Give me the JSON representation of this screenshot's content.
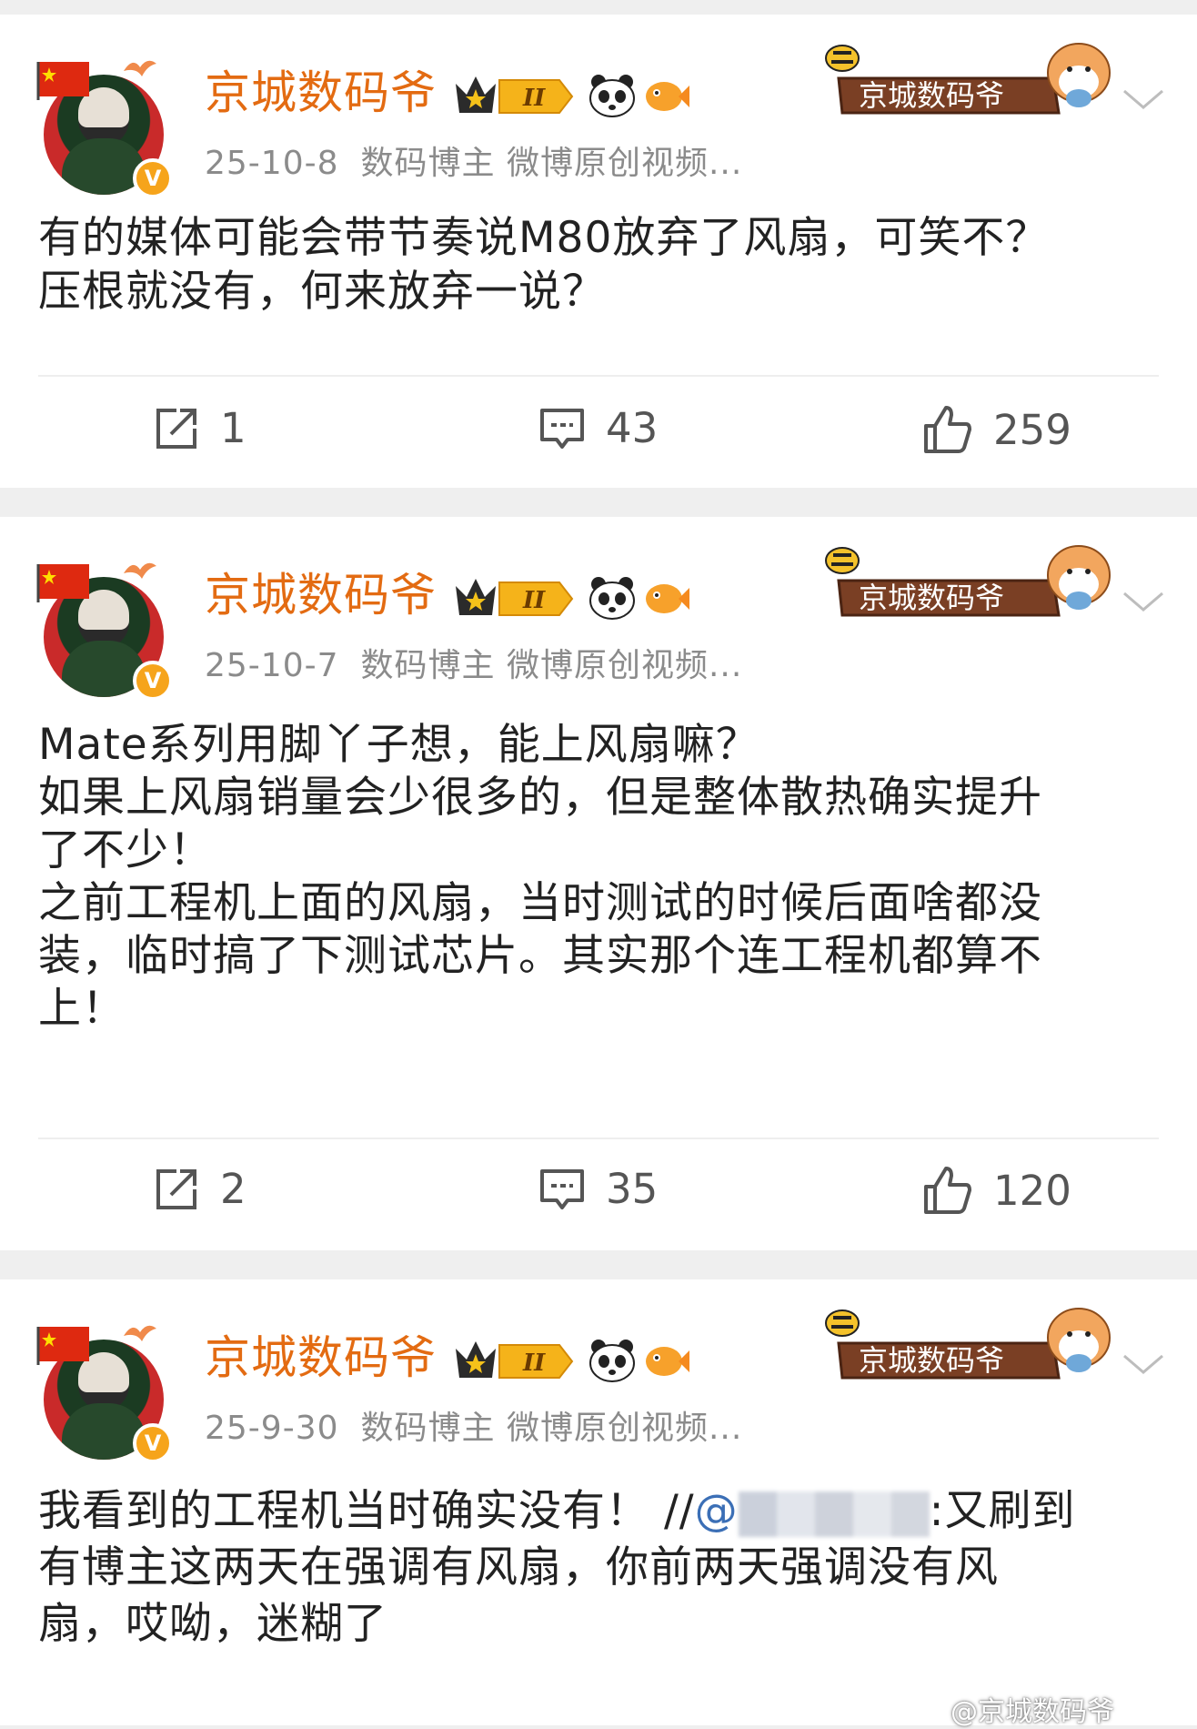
{
  "posts": [
    {
      "username": "京城数码爷",
      "date": "25-10-8",
      "source": "数码博主 微博原创视频...",
      "banner_text": "京城数码爷",
      "lines": [
        "有的媒体可能会带节奏说M80放弃了风扇，可笑不？",
        "压根就没有，何来放弃一说？"
      ],
      "repost_count": "1",
      "comment_count": "43",
      "like_count": "259"
    },
    {
      "username": "京城数码爷",
      "date": "25-10-7",
      "source": "数码博主 微博原创视频...",
      "banner_text": "京城数码爷",
      "lines": [
        "Mate系列用脚丫子想，能上风扇嘛？",
        "如果上风扇销量会少很多的，但是整体散热确实提升",
        "了不少！",
        "之前工程机上面的风扇，当时测试的时候后面啥都没",
        "装，临时搞了下测试芯片。其实那个连工程机都算不",
        "上！"
      ],
      "repost_count": "2",
      "comment_count": "35",
      "like_count": "120"
    },
    {
      "username": "京城数码爷",
      "date": "25-9-30",
      "source": "数码博主 微博原创视频...",
      "banner_text": "京城数码爷",
      "line1_pre": "我看到的工程机当时确实没有！ //",
      "line1_at": "@",
      "line1_post": ":又刷到",
      "lines": [
        "有博主这两天在强调有风扇，你前两天强调没有风",
        "扇，哎呦，迷糊了"
      ]
    }
  ],
  "watermark": "@京城数码爷",
  "colors": {
    "username": "#e36b12",
    "meta": "#8b8b8b",
    "text": "#222222",
    "background": "#efefef"
  },
  "icons": [
    "repost-icon",
    "comment-icon",
    "like-icon",
    "vip-crown-icon",
    "panda-icon",
    "fish-icon",
    "chevron-down-icon",
    "verified-badge-icon"
  ]
}
